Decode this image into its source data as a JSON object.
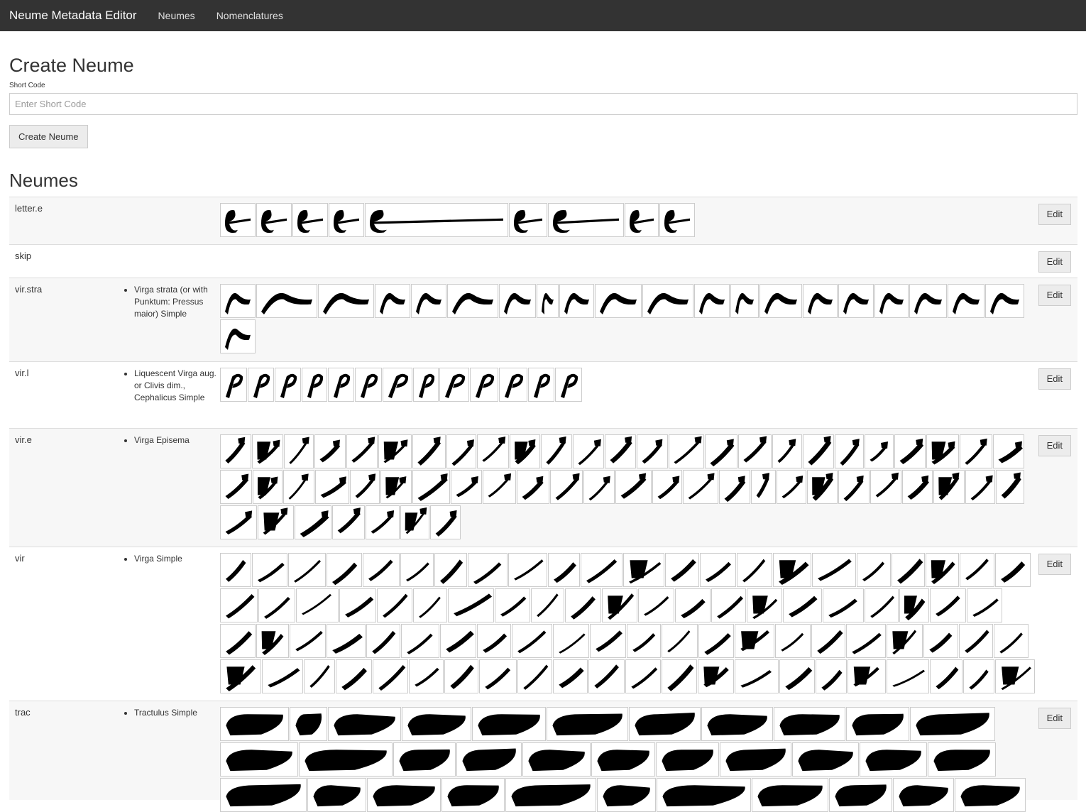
{
  "navbar": {
    "brand": "Neume Metadata Editor",
    "links": [
      "Neumes",
      "Nomenclatures"
    ],
    "bg_color": "#333333"
  },
  "create_form": {
    "title": "Create Neume",
    "short_code_label": "Short Code",
    "short_code_placeholder": "Enter Short Code",
    "short_code_value": "",
    "submit_label": "Create Neume"
  },
  "list_title": "Neumes",
  "edit_label": "Edit",
  "neumes": [
    {
      "code": "letter.e",
      "descriptions": [],
      "image_count": 9,
      "image_icon": "letter-e-glyph-image"
    },
    {
      "code": "skip",
      "descriptions": [],
      "image_count": 0,
      "image_icon": ""
    },
    {
      "code": "vir.stra",
      "descriptions": [
        "Virga strata (or with Punktum: Pressus maior) Simple"
      ],
      "image_count": 21,
      "image_icon": "virga-strata-glyph-image"
    },
    {
      "code": "vir.l",
      "descriptions": [
        "Liquescent Virga aug. or Clivis dim., Cephalicus Simple"
      ],
      "image_count": 13,
      "image_icon": "liquescent-virga-glyph-image"
    },
    {
      "code": "vir.e",
      "descriptions": [
        "Virga Episema"
      ],
      "image_count": 57,
      "image_icon": "virga-episema-glyph-image"
    },
    {
      "code": "vir",
      "descriptions": [
        "Virga Simple"
      ],
      "image_count": 87,
      "image_icon": "virga-glyph-image"
    },
    {
      "code": "trac",
      "descriptions": [
        "Tractulus Simple"
      ],
      "image_count": 33,
      "image_icon": "tractulus-glyph-image"
    }
  ]
}
